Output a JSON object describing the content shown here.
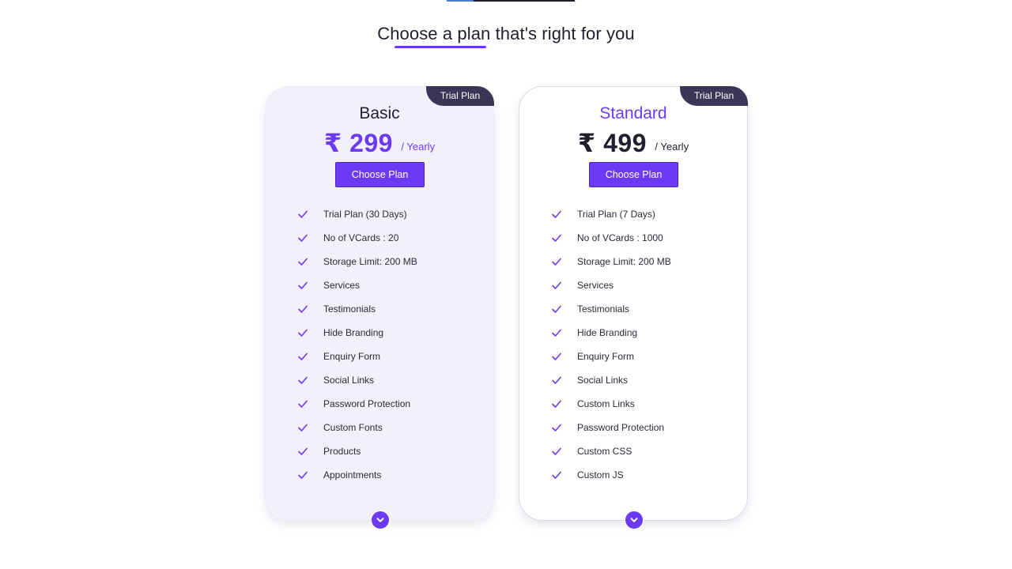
{
  "section": {
    "title": "Choose a plan that's right for you"
  },
  "colors": {
    "accent": "#6c3af2",
    "badge_bg": "#3a3658",
    "basic_card_bg": "#f1f0fc"
  },
  "plans": [
    {
      "badge": "Trial Plan",
      "name": "Basic",
      "price": "₹ 299",
      "period": "/ Yearly",
      "button_label": "Choose Plan",
      "features": [
        "Trial Plan (30 Days)",
        "No of VCards : 20",
        "Storage Limit: 200 MB",
        "Services",
        "Testimonials",
        "Hide Branding",
        "Enquiry Form",
        "Social Links",
        "Password Protection",
        "Custom Fonts",
        "Products",
        "Appointments"
      ],
      "feature_icon": "check-icon",
      "expand_icon": "chevron-down-icon"
    },
    {
      "badge": "Trial Plan",
      "name": "Standard",
      "price": "₹ 499",
      "period": "/ Yearly",
      "button_label": "Choose Plan",
      "features": [
        "Trial Plan (7 Days)",
        "No of VCards : 1000",
        "Storage Limit: 200 MB",
        "Services",
        "Testimonials",
        "Hide Branding",
        "Enquiry Form",
        "Social Links",
        "Custom Links",
        "Password Protection",
        "Custom CSS",
        "Custom JS"
      ],
      "feature_icon": "check-icon",
      "expand_icon": "chevron-down-icon"
    }
  ]
}
